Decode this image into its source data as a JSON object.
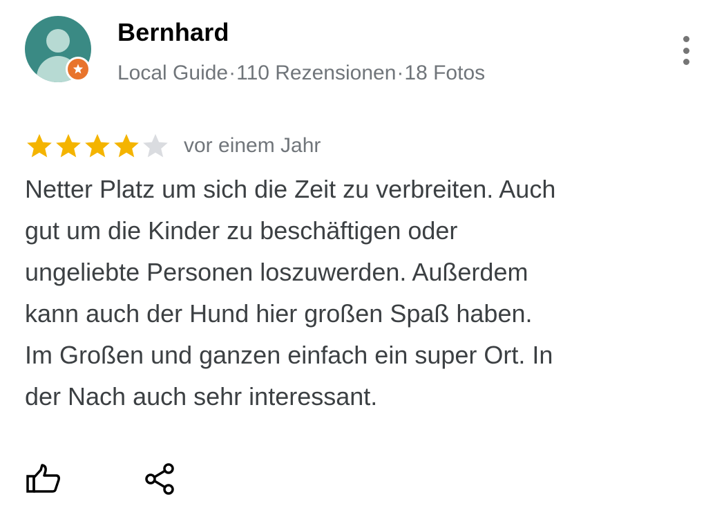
{
  "reviewer": {
    "name": "Bernhard",
    "badge": "Local Guide",
    "reviews": "110 Rezensionen",
    "photos": "18 Fotos",
    "separator": "·",
    "avatar_color": "#3a8a84",
    "badge_color": "#e8742c"
  },
  "rating": {
    "value": 4,
    "max": 5,
    "filled_color": "#f4b400",
    "empty_color": "#dadce0",
    "time": "vor einem Jahr"
  },
  "review": {
    "text": "Netter Platz um sich die Zeit zu verbreiten. Auch\ngut um die Kinder zu beschäftigen oder\nungeliebte Personen loszuwerden. Außerdem\nkann auch der Hund hier großen Spaß haben.\nIm Großen und ganzen einfach ein super Ort. In\nder Nach auch sehr interessant."
  },
  "actions": {
    "like_icon": "thumbs-up-icon",
    "share_icon": "share-icon",
    "more_icon": "more-vert-icon"
  }
}
